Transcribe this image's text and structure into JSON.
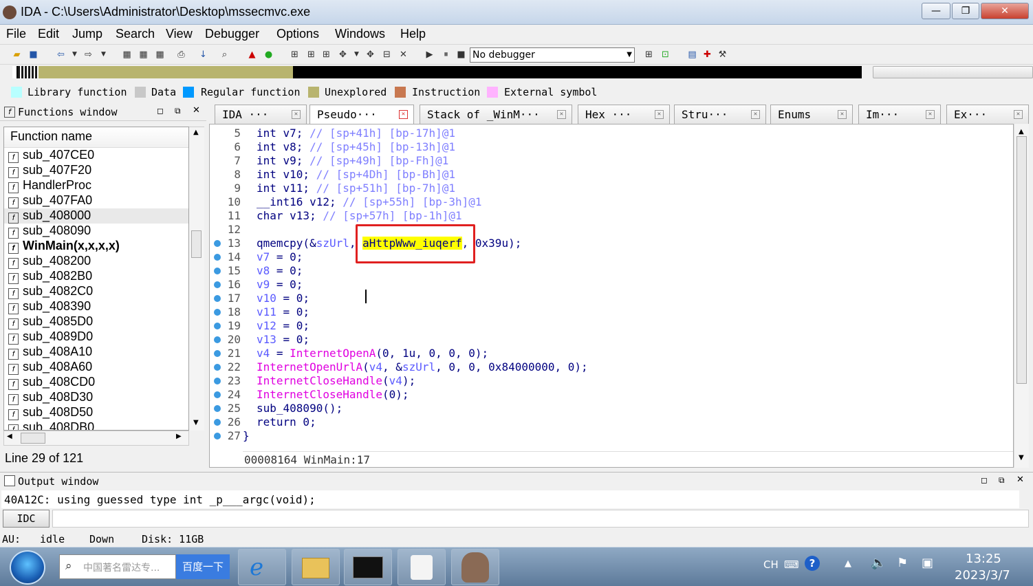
{
  "window": {
    "title": "IDA - C:\\Users\\Administrator\\Desktop\\mssecmvc.exe",
    "minimize": "—",
    "maximize": "❐",
    "close": "✕"
  },
  "menu": [
    "File",
    "Edit",
    "Jump",
    "Search",
    "View",
    "Debugger",
    "Options",
    "Windows",
    "Help"
  ],
  "toolbar": {
    "debugger_value": "No debugger"
  },
  "legend": [
    {
      "label": "Library function",
      "color": "#b8ffff"
    },
    {
      "label": "Data",
      "color": "#c8c8c8"
    },
    {
      "label": "Regular function",
      "color": "#0099ff"
    },
    {
      "label": "Unexplored",
      "color": "#b8b46e"
    },
    {
      "label": "Instruction",
      "color": "#c87850"
    },
    {
      "label": "External symbol",
      "color": "#ffb3ff"
    }
  ],
  "functions_window": {
    "title": "Functions window",
    "column": "Function name",
    "items": [
      "sub_407CE0",
      "sub_407F20",
      "HandlerProc",
      "sub_407FA0",
      "sub_408000",
      "sub_408090",
      "WinMain(x,x,x,x)",
      "sub_408200",
      "sub_4082B0",
      "sub_4082C0",
      "sub_408390",
      "sub_4085D0",
      "sub_4089D0",
      "sub_408A10",
      "sub_408A60",
      "sub_408CD0",
      "sub_408D30",
      "sub_408D50",
      "sub_408DB0"
    ],
    "status": "Line 29 of 121"
  },
  "tabs": [
    "IDA ···",
    "Pseudo···",
    "Stack of _WinM···",
    "Hex ···",
    "Stru···",
    "Enums",
    "Im···",
    "Ex···"
  ],
  "code": {
    "line_numbers": [
      "5",
      "6",
      "7",
      "8",
      "9",
      "10",
      "11",
      "12",
      "13",
      "14",
      "15",
      "16",
      "17",
      "18",
      "19",
      "20",
      "21",
      "22",
      "23",
      "24",
      "25",
      "26",
      "27"
    ],
    "status": "00008164 WinMain:17"
  },
  "output": {
    "title": "Output window",
    "text": "40A12C: using guessed type int _p___argc(void);",
    "idc_label": "IDC"
  },
  "status": {
    "au": "AU:",
    "state": "idle",
    "dir": "Down",
    "disk": "Disk: 11GB"
  },
  "taskbar": {
    "search_placeholder": "中国著名雷达专...",
    "search_button": "百度一下",
    "lang": "CH",
    "time": "13:25",
    "date": "2023/3/7"
  }
}
